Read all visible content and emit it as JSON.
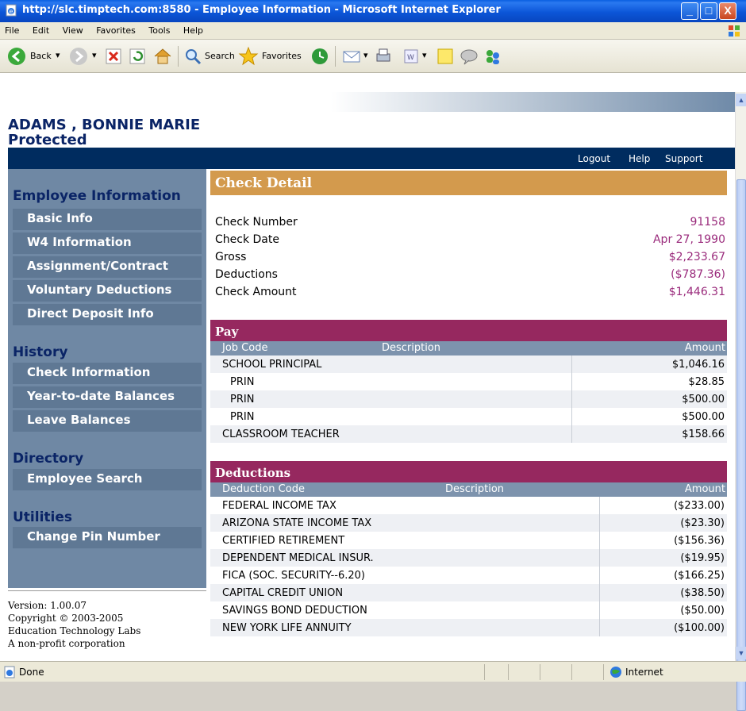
{
  "window": {
    "title": "http://slc.timptech.com:8580 - Employee Information - Microsoft Internet Explorer",
    "min_glyph": "_",
    "max_glyph": "□",
    "close_glyph": "X"
  },
  "menu": [
    "File",
    "Edit",
    "View",
    "Favorites",
    "Tools",
    "Help"
  ],
  "toolbar": {
    "back_label": "Back",
    "search_label": "Search",
    "favorites_label": "Favorites"
  },
  "employee": {
    "name": "ADAMS , BONNIE  MARIE",
    "status": "Protected"
  },
  "topnav": {
    "logout": "Logout",
    "help": "Help",
    "support": "Support"
  },
  "sidebar": {
    "section1": "Employee Information",
    "basic_info": "Basic Info",
    "w4": "W4 Information",
    "assignment": "Assignment/Contract",
    "voluntary": "Voluntary Deductions",
    "direct_deposit": "Direct Deposit Info",
    "section2": "History",
    "check_info": "Check Information",
    "ytd": "Year-to-date Balances",
    "leave": "Leave Balances",
    "section3": "Directory",
    "emp_search": "Employee Search",
    "section4": "Utilities",
    "change_pin": "Change Pin Number"
  },
  "footer": {
    "version": "Version: 1.00.07",
    "copyright": "Copyright © 2003-2005",
    "org": "Education Technology Labs",
    "nonprofit": "A non-profit corporation"
  },
  "check": {
    "header": "Check Detail",
    "rows": [
      {
        "label": "Check Number",
        "value": "91158"
      },
      {
        "label": "Check Date",
        "value": "Apr 27, 1990"
      },
      {
        "label": "Gross",
        "value": "$2,233.67"
      },
      {
        "label": "Deductions",
        "value": "($787.36)"
      },
      {
        "label": "Check Amount",
        "value": "$1,446.31"
      }
    ]
  },
  "pay": {
    "header": "Pay",
    "col_job": "Job Code",
    "col_desc": "Description",
    "col_amount": "Amount",
    "rows": [
      {
        "code": "SCHOOL PRINCIPAL",
        "amount": "$1,046.16"
      },
      {
        "code": "PRIN",
        "amount": "$28.85"
      },
      {
        "code": "PRIN",
        "amount": "$500.00"
      },
      {
        "code": "PRIN",
        "amount": "$500.00"
      },
      {
        "code": "CLASSROOM TEACHER",
        "amount": "$158.66"
      }
    ]
  },
  "deductions": {
    "header": "Deductions",
    "col_code": "Deduction Code",
    "col_desc": "Description",
    "col_amount": "Amount",
    "rows": [
      {
        "code": "FEDERAL INCOME TAX",
        "amount": "($233.00)"
      },
      {
        "code": "ARIZONA STATE INCOME TAX",
        "amount": "($23.30)"
      },
      {
        "code": "CERTIFIED RETIREMENT",
        "amount": "($156.36)"
      },
      {
        "code": "DEPENDENT MEDICAL INSUR.",
        "amount": "($19.95)"
      },
      {
        "code": "FICA (SOC. SECURITY--6.20)",
        "amount": "($166.25)"
      },
      {
        "code": "CAPITAL CREDIT UNION",
        "amount": "($38.50)"
      },
      {
        "code": "SAVINGS BOND DEDUCTION",
        "amount": "($50.00)"
      },
      {
        "code": "NEW YORK LIFE ANNUITY",
        "amount": "($100.00)"
      }
    ]
  },
  "status": {
    "left": "Done",
    "zone": "Internet"
  }
}
